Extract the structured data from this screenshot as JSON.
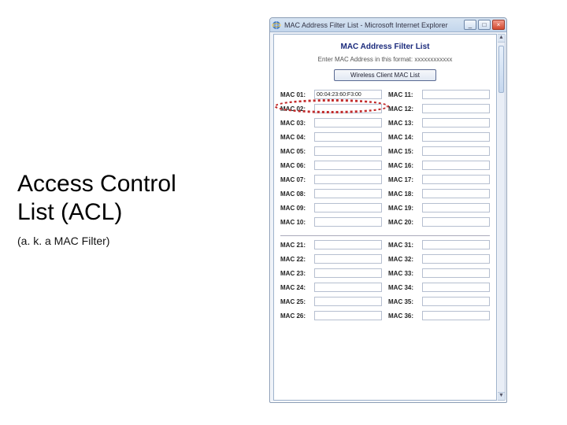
{
  "slide": {
    "title_line1": "Access Control",
    "title_line2": "List (ACL)",
    "subtitle": "(a. k. a MAC Filter)"
  },
  "browser": {
    "title": "MAC Address Filter List - Microsoft Internet Explorer",
    "min": "_",
    "max": "□",
    "close": "×"
  },
  "page": {
    "heading": "MAC Address Filter List",
    "instruction": "Enter MAC Address in this format: xxxxxxxxxxxx",
    "wireless_button": "Wireless Client MAC List"
  },
  "mac": {
    "sample_value": "00:04:23:60:F3:00",
    "labels": {
      "m01": "MAC 01:",
      "m02": "MAC 02:",
      "m03": "MAC 03:",
      "m04": "MAC 04:",
      "m05": "MAC 05:",
      "m06": "MAC 06:",
      "m07": "MAC 07:",
      "m08": "MAC 08:",
      "m09": "MAC 09:",
      "m10": "MAC 10:",
      "m11": "MAC 11:",
      "m12": "MAC 12:",
      "m13": "MAC 13:",
      "m14": "MAC 14:",
      "m15": "MAC 15:",
      "m16": "MAC 16:",
      "m17": "MAC 17:",
      "m18": "MAC 18:",
      "m19": "MAC 19:",
      "m20": "MAC 20:",
      "m21": "MAC 21:",
      "m22": "MAC 22:",
      "m23": "MAC 23:",
      "m24": "MAC 24:",
      "m25": "MAC 25:",
      "m26": "MAC 26:",
      "m31": "MAC 31:",
      "m32": "MAC 32:",
      "m33": "MAC 33:",
      "m34": "MAC 34:",
      "m35": "MAC 35:",
      "m36": "MAC 36:"
    }
  }
}
